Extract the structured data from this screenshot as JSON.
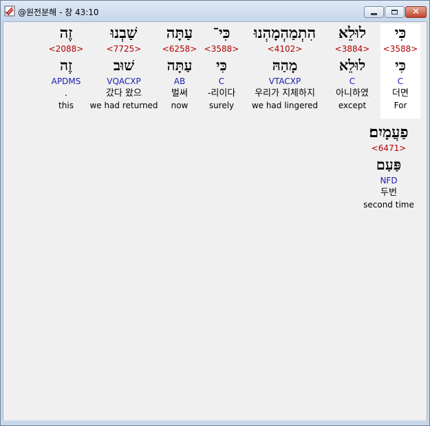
{
  "window": {
    "title": "@원전분해 - 창 43:10",
    "controls": {
      "minimize_icon": "minimize-icon",
      "maximize_icon": "maximize-icon",
      "close_icon": "close-icon",
      "close_glyph": "✕"
    }
  },
  "words": [
    {
      "hebrew": "כִּי",
      "strong": "<3588>",
      "lemma": "כִּי",
      "morph": "C",
      "korean": "더면",
      "english": "For"
    },
    {
      "hebrew": "לוּלֵא",
      "strong": "<3884>",
      "lemma": "לוּלֵא",
      "morph": "C",
      "korean": "아니하였",
      "english": "except"
    },
    {
      "hebrew": "הִתְמַהְמָהְנוּ",
      "strong": "<4102>",
      "lemma": "מָהַהּ",
      "morph": "VTACXP",
      "korean": "우리가 지체하지",
      "english": "we had lingered"
    },
    {
      "hebrew": "כִּי־",
      "strong": "<3588>",
      "lemma": "כִּי",
      "morph": "C",
      "korean": "-리이다",
      "english": "surely"
    },
    {
      "hebrew": "עַתָּה",
      "strong": "<6258>",
      "lemma": "עַתָּה",
      "morph": "AB",
      "korean": "벌써",
      "english": "now"
    },
    {
      "hebrew": "שַׁבְנוּ",
      "strong": "<7725>",
      "lemma": "שׁוּב",
      "morph": "VQACXP",
      "korean": "갔다 왔으",
      "english": "we had returned"
    },
    {
      "hebrew": "זֶה",
      "strong": "<2088>",
      "lemma": "זֶה",
      "morph": "APDMS",
      "korean": ".",
      "english": "this"
    },
    {
      "hebrew": "פַעֲמָיִם׃",
      "strong": "<6471>",
      "lemma": "פַּעַם",
      "morph": "NFD",
      "korean": "두번",
      "english": "second time"
    }
  ]
}
